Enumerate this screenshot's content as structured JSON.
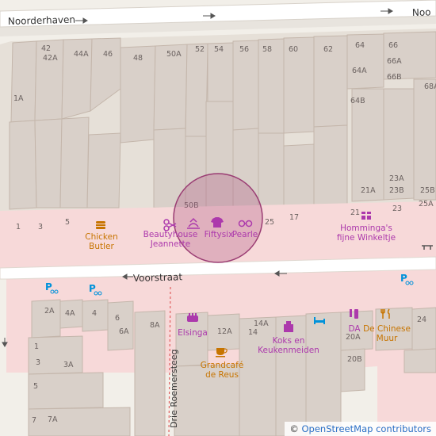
{
  "streets": {
    "noorderhaven": "Noorderhaven",
    "noorderhaven_right": "Noo",
    "voorstraat": "Voorstraat",
    "drie_roemersteeg": "Drie Roemersteeg"
  },
  "house_numbers": {
    "top_row": [
      "42",
      "42A",
      "44A",
      "46",
      "48",
      "50A",
      "52",
      "54",
      "56",
      "58",
      "60",
      "62",
      "64",
      "66",
      "66A",
      "64A",
      "66B",
      "68A",
      "64B"
    ],
    "mid": [
      "1A",
      "50B",
      "23A",
      "23B",
      "25B",
      "21A",
      "25A",
      "21",
      "23"
    ],
    "front_north": [
      "1",
      "3",
      "5",
      "25",
      "17"
    ],
    "south": [
      "2A",
      "4A",
      "4",
      "6",
      "6A",
      "8A",
      "12A",
      "14A",
      "14",
      "24",
      "20A",
      "20B",
      "1",
      "3",
      "3A",
      "5",
      "7",
      "7A"
    ]
  },
  "pois": {
    "chicken_butler": "Chicken\nButler",
    "beautyhouse": "Beautyhouse\nJeannette",
    "fiftysix": "Fiftysix",
    "pearle": "Pearle",
    "homminga": "Homminga's\nfijne Winkeltje",
    "elsinga": "Elsinga",
    "koks": "Koks en\nKeukenmeiden",
    "da": "DA",
    "chinese_muur": "De Chinese\nMuur",
    "grandcafe": "Grandcafé\nde Reus"
  },
  "icons": [
    "fast-food-icon",
    "hairdresser-icon",
    "toy-icon",
    "clothes-icon",
    "optician-icon",
    "gift-icon",
    "cosmetics-icon",
    "kitchen-icon",
    "bed-icon",
    "chemist-icon",
    "restaurant-icon",
    "cafe-icon",
    "bicycle-parking-icon",
    "bench-icon"
  ],
  "colors": {
    "pedestrian": "#f7d9d9",
    "building": "#d9d0c9",
    "building_edge": "#c4b6ab",
    "highlight": "#b05a87"
  },
  "attribution": {
    "copyright": "©",
    "text": "OpenStreetMap contributors"
  }
}
